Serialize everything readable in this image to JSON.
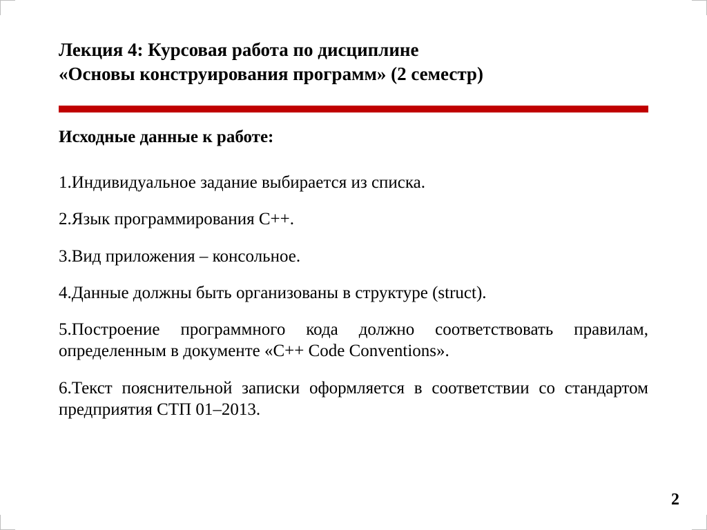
{
  "title": {
    "line1": "Лекция 4: Курсовая работа по дисциплине",
    "line2": "«Основы конструирования программ» (2 семестр)"
  },
  "subhead": "Исходные данные к работе:",
  "items": [
    "1.Индивидуальное задание выбирается из списка.",
    "2.Язык программирования С++.",
    "3.Вид приложения – консольное.",
    "4.Данные должны быть организованы в структуре (struct).",
    "5.Построение программного кода должно соответствовать правилам, определенным в документе «С++ Code Conventions».",
    "6.Текст пояснительной записки оформляется в соответствии со стандартом предприятия  СТП  01–2013."
  ],
  "page_number": "2"
}
